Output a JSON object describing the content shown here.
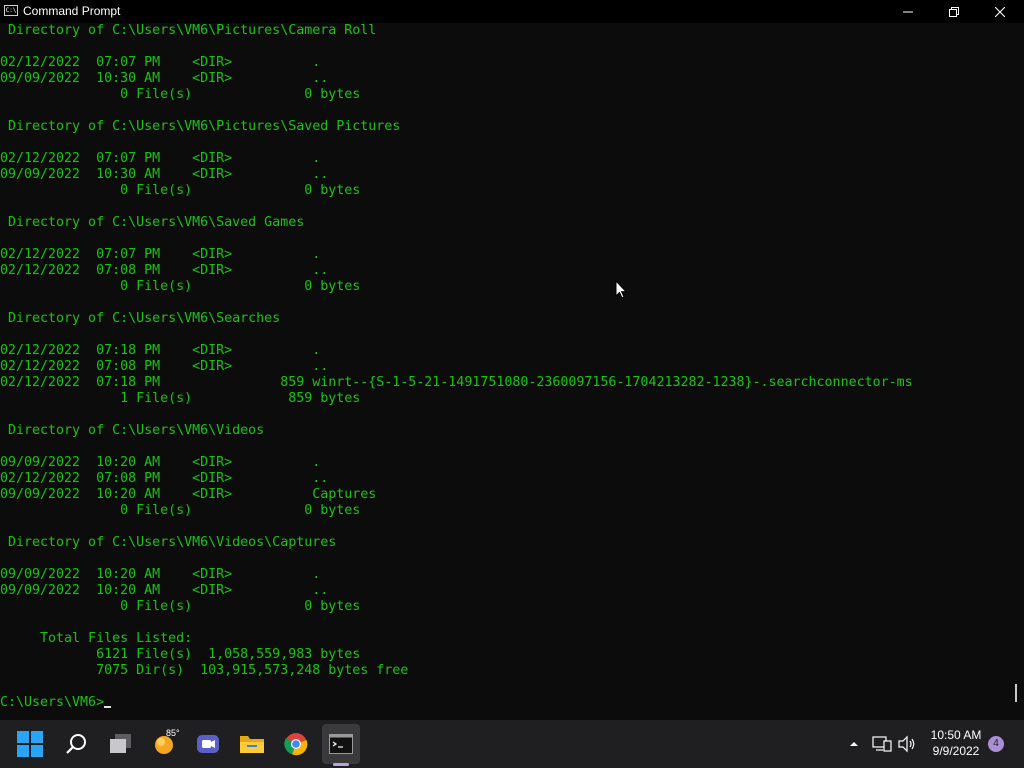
{
  "window": {
    "title": "Command Prompt",
    "icon": "cmd-icon",
    "icon_text": "C:\\",
    "controls": [
      "minimize-icon",
      "restore-icon",
      "close-icon"
    ]
  },
  "console": {
    "text_color": "#16c60c",
    "background": "#0c0c0c",
    "lines": [
      " Directory of C:\\Users\\VM6\\Pictures\\Camera Roll",
      "",
      "02/12/2022  07:07 PM    <DIR>          .",
      "09/09/2022  10:30 AM    <DIR>          ..",
      "               0 File(s)              0 bytes",
      "",
      " Directory of C:\\Users\\VM6\\Pictures\\Saved Pictures",
      "",
      "02/12/2022  07:07 PM    <DIR>          .",
      "09/09/2022  10:30 AM    <DIR>          ..",
      "               0 File(s)              0 bytes",
      "",
      " Directory of C:\\Users\\VM6\\Saved Games",
      "",
      "02/12/2022  07:07 PM    <DIR>          .",
      "02/12/2022  07:08 PM    <DIR>          ..",
      "               0 File(s)              0 bytes",
      "",
      " Directory of C:\\Users\\VM6\\Searches",
      "",
      "02/12/2022  07:18 PM    <DIR>          .",
      "02/12/2022  07:08 PM    <DIR>          ..",
      "02/12/2022  07:18 PM               859 winrt--{S-1-5-21-1491751080-2360097156-1704213282-1238}-.searchconnector-ms",
      "               1 File(s)            859 bytes",
      "",
      " Directory of C:\\Users\\VM6\\Videos",
      "",
      "09/09/2022  10:20 AM    <DIR>          .",
      "02/12/2022  07:08 PM    <DIR>          ..",
      "09/09/2022  10:20 AM    <DIR>          Captures",
      "               0 File(s)              0 bytes",
      "",
      " Directory of C:\\Users\\VM6\\Videos\\Captures",
      "",
      "09/09/2022  10:20 AM    <DIR>          .",
      "09/09/2022  10:20 AM    <DIR>          ..",
      "               0 File(s)              0 bytes",
      "",
      "     Total Files Listed:",
      "            6121 File(s)  1,058,559,983 bytes",
      "            7075 Dir(s)  103,915,573,248 bytes free",
      ""
    ],
    "prompt": "C:\\Users\\VM6>"
  },
  "taskbar": {
    "background": "#1f1f22",
    "items": [
      {
        "name": "start-button",
        "icon": "windows-logo-icon"
      },
      {
        "name": "search-button",
        "icon": "search-icon"
      },
      {
        "name": "task-view-button",
        "icon": "task-view-icon"
      },
      {
        "name": "weather-widget",
        "icon": "weather-sun-icon"
      },
      {
        "name": "meet-now-button",
        "icon": "video-camera-icon"
      },
      {
        "name": "file-explorer-button",
        "icon": "folder-icon"
      },
      {
        "name": "chrome-button",
        "icon": "chrome-icon"
      },
      {
        "name": "command-prompt-button",
        "icon": "cmd-icon"
      }
    ],
    "weather_temp": "85°",
    "tray": {
      "icons": [
        "chevron-up-icon",
        "network-icon",
        "volume-icon"
      ],
      "time": "10:50 AM",
      "date": "9/9/2022",
      "notifications": "4"
    }
  }
}
